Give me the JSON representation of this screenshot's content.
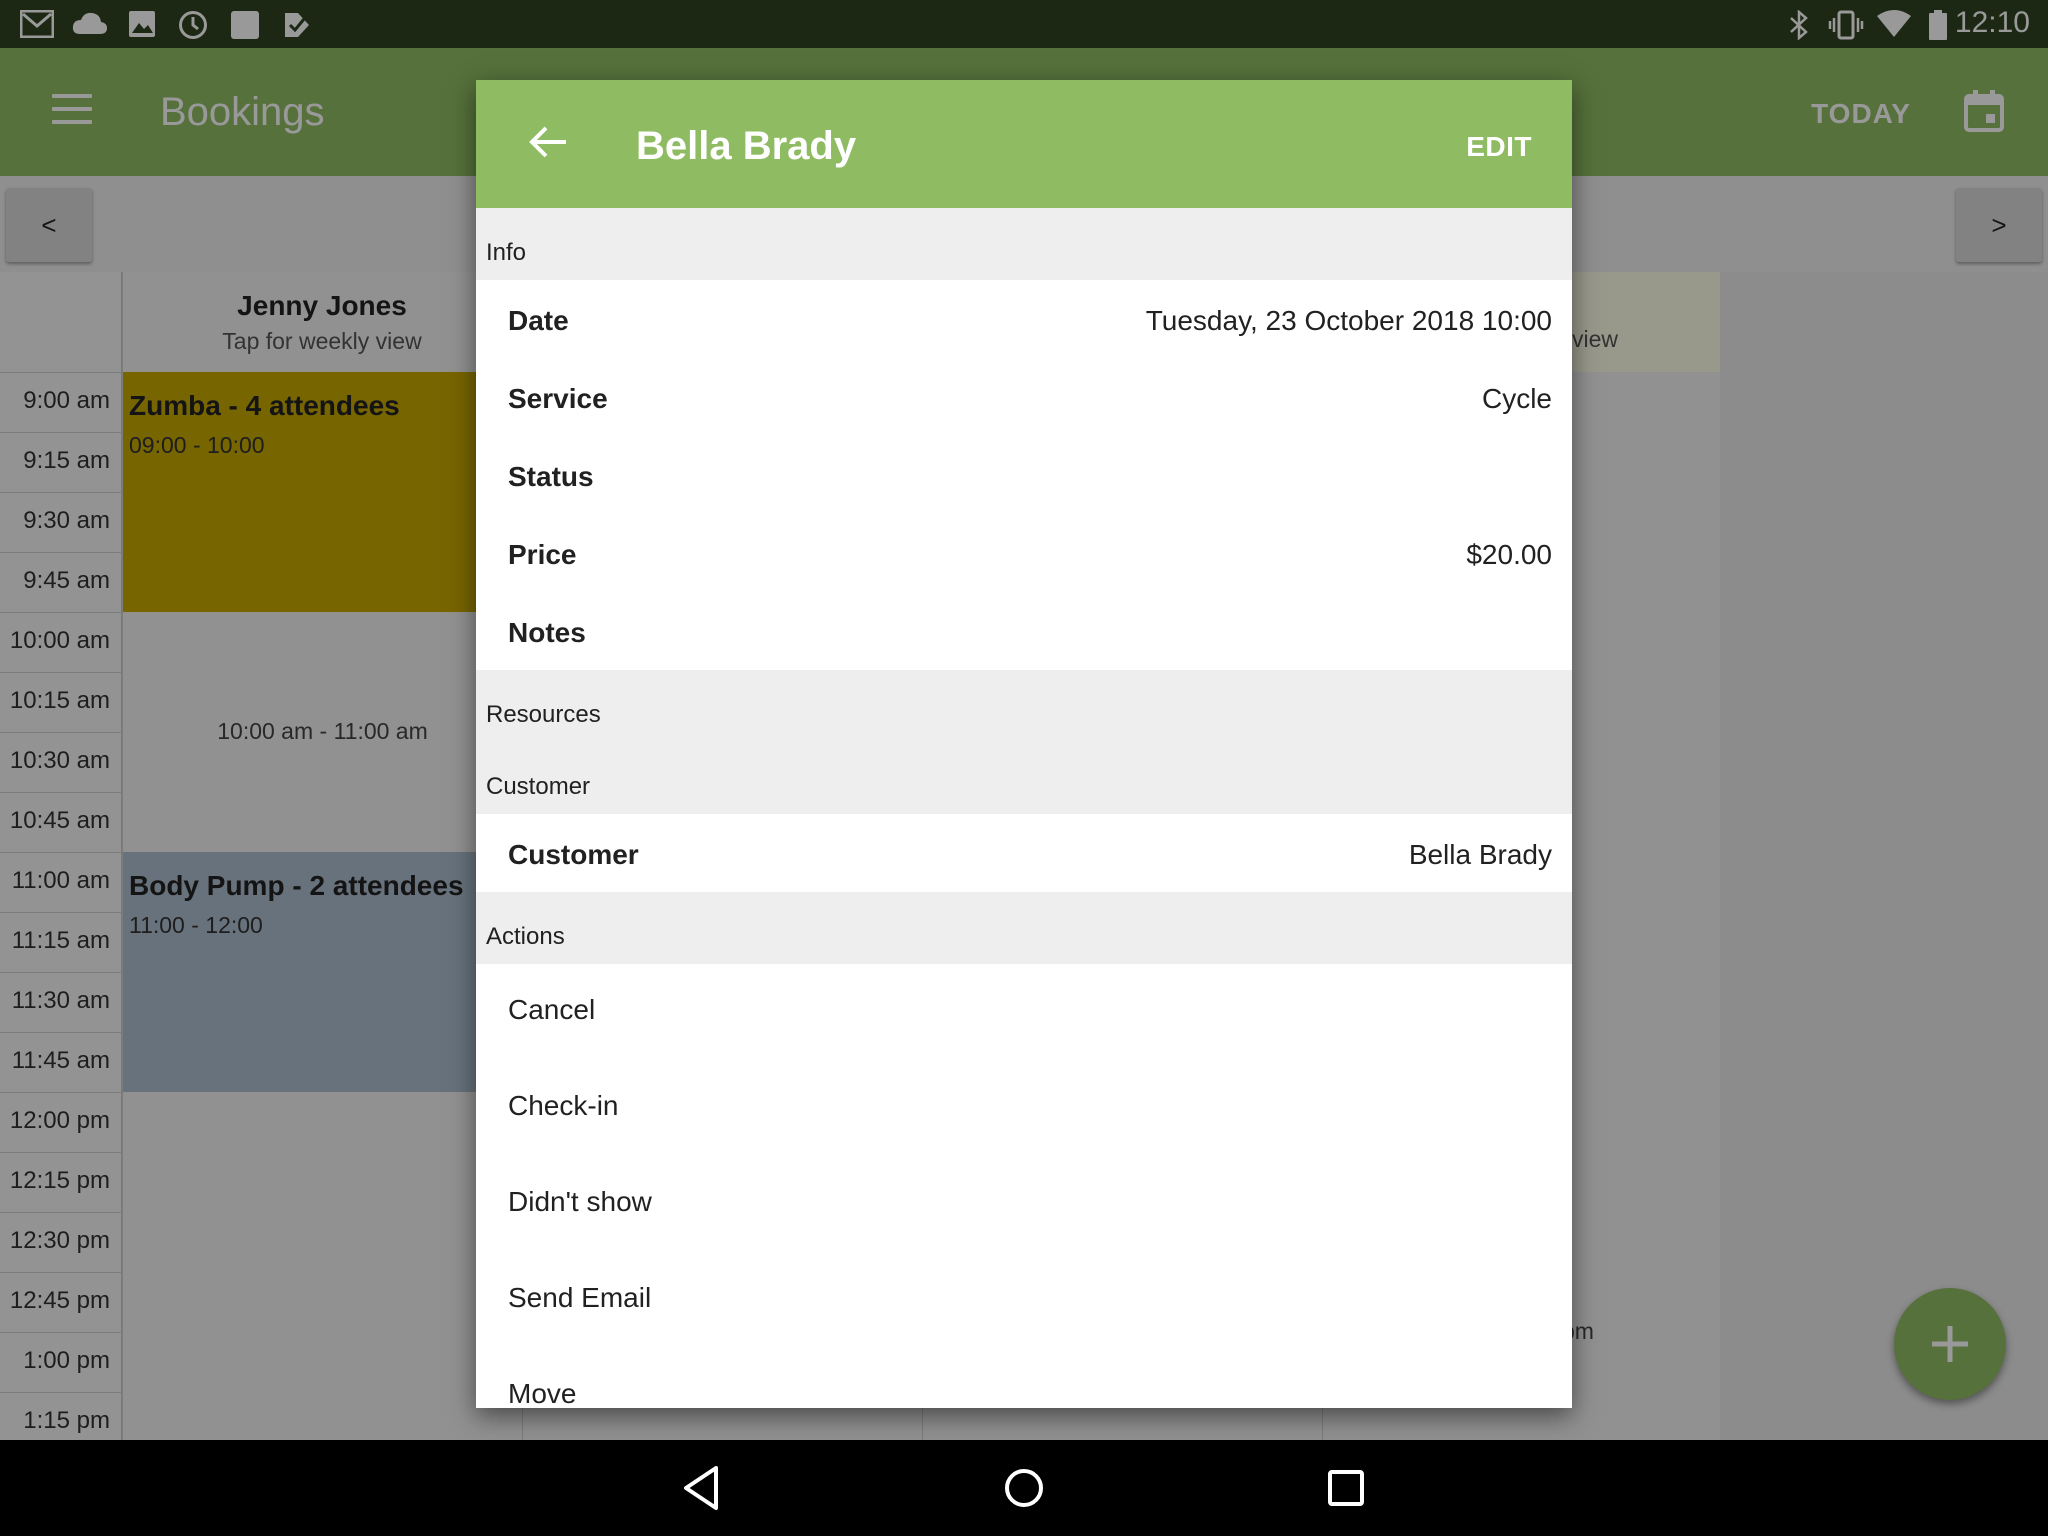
{
  "status_bar": {
    "time": "12:10",
    "left_icons": [
      "gmail-icon",
      "cloud-icon",
      "image-icon",
      "clock-icon",
      "square-icon",
      "checkmark-app-icon"
    ],
    "right_icons": [
      "bluetooth-icon",
      "vibrate-icon",
      "wifi-icon",
      "battery-icon"
    ]
  },
  "app_bar": {
    "title": "Bookings",
    "today_label": "TODAY"
  },
  "nav": {
    "prev_label": "<",
    "next_label": ">"
  },
  "calendar": {
    "column_1": {
      "name": "Jenny Jones",
      "subtitle": "Tap for weekly view"
    },
    "column_2": {
      "subtitle_fragment": "view",
      "time_fragment": "pm"
    },
    "times": [
      "9:00 am",
      "9:15 am",
      "9:30 am",
      "9:45 am",
      "10:00 am",
      "10:15 am",
      "10:30 am",
      "10:45 am",
      "11:00 am",
      "11:15 am",
      "11:30 am",
      "11:45 am",
      "12:00 pm",
      "12:15 pm",
      "12:30 pm",
      "12:45 pm",
      "1:00 pm",
      "1:15 pm"
    ],
    "events": [
      {
        "title": "Zumba - 4 attendees",
        "range": "09:00 - 10:00",
        "color": "#c6a800"
      },
      {
        "title": "Body Pump - 2 attendees",
        "range": "11:00 - 12:00",
        "color": "#aebfcf"
      }
    ],
    "free_slot": "10:00 am - 11:00 am"
  },
  "dialog": {
    "title": "Bella Brady",
    "edit_label": "EDIT",
    "info_section": "Info",
    "fields": [
      {
        "label": "Date",
        "value": "Tuesday, 23 October 2018 10:00"
      },
      {
        "label": "Service",
        "value": "Cycle"
      },
      {
        "label": "Status",
        "value": ""
      },
      {
        "label": "Price",
        "value": "$20.00"
      },
      {
        "label": "Notes",
        "value": ""
      }
    ],
    "resources_section": "Resources",
    "customer_section": "Customer",
    "customer_row": {
      "label": "Customer",
      "value": "Bella Brady"
    },
    "actions_section": "Actions",
    "actions": [
      "Cancel",
      "Check-in",
      "Didn't show",
      "Send Email",
      "Move"
    ]
  },
  "colors": {
    "primary": "#8fbc63",
    "status_bar": "#2f4420",
    "section_bg": "#eeeeee"
  }
}
